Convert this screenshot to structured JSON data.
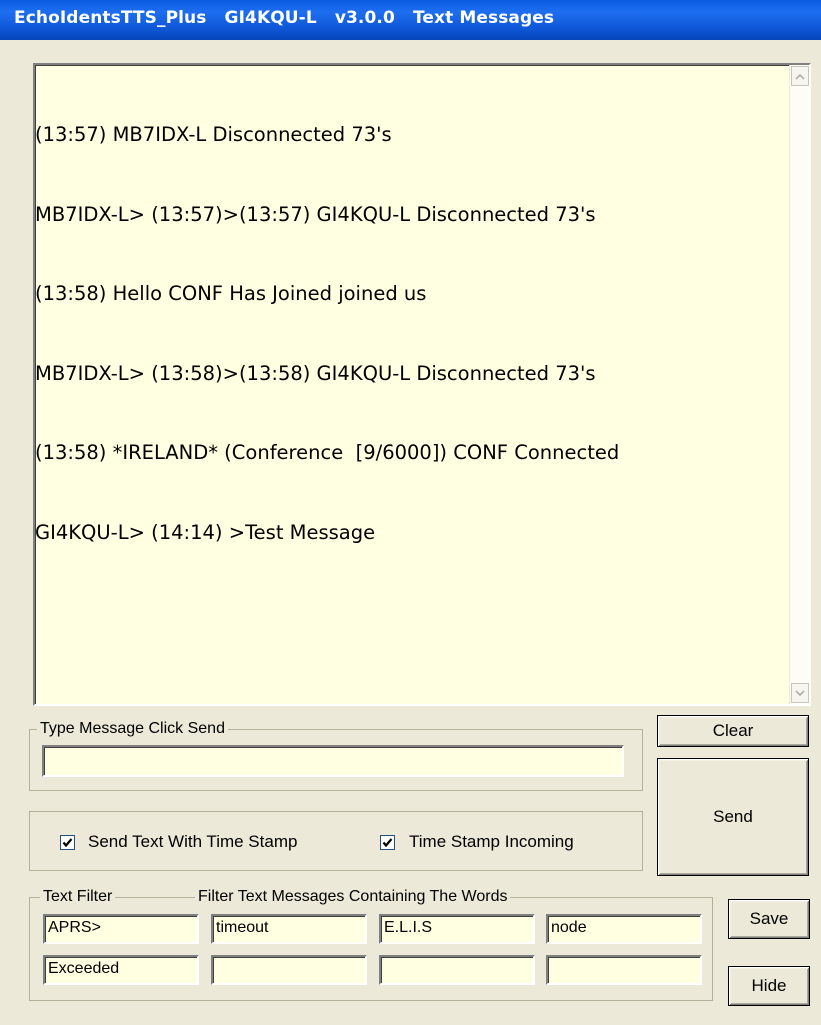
{
  "window": {
    "title": "EchoIdentsTTS_Plus   GI4KQU-L   v3.0.0   Text Messages"
  },
  "log": {
    "lines": [
      "(13:57) MB7IDX-L Disconnected 73's",
      "MB7IDX-L> (13:57)>(13:57) GI4KQU-L Disconnected 73's",
      "(13:58) Hello CONF Has Joined joined us",
      "MB7IDX-L> (13:58)>(13:58) GI4KQU-L Disconnected 73's",
      "(13:58) *IRELAND* (Conference  [9/6000]) CONF Connected",
      "GI4KQU-L> (14:14) >Test Message"
    ],
    "scroll_up_icon": "chevron-up-icon",
    "scroll_down_icon": "chevron-down-icon"
  },
  "message": {
    "group_label": "Type Message Click Send",
    "value": ""
  },
  "buttons": {
    "clear": "Clear",
    "send": "Send",
    "save": "Save",
    "hide": "Hide"
  },
  "options": {
    "send_timestamp": {
      "label": "Send Text With Time Stamp",
      "checked": true
    },
    "timestamp_incoming": {
      "label": "Time Stamp Incoming",
      "checked": true
    }
  },
  "filter": {
    "label": "Text Filter",
    "description": "Filter Text Messages Containing The Words",
    "fields": [
      "APRS>",
      "timeout",
      "E.L.I.S",
      "node",
      "Exceeded",
      "",
      "",
      ""
    ]
  },
  "colors": {
    "title_bar": "#0a5be0",
    "window_bg": "#ece9d8",
    "field_bg": "#ffffe1"
  }
}
